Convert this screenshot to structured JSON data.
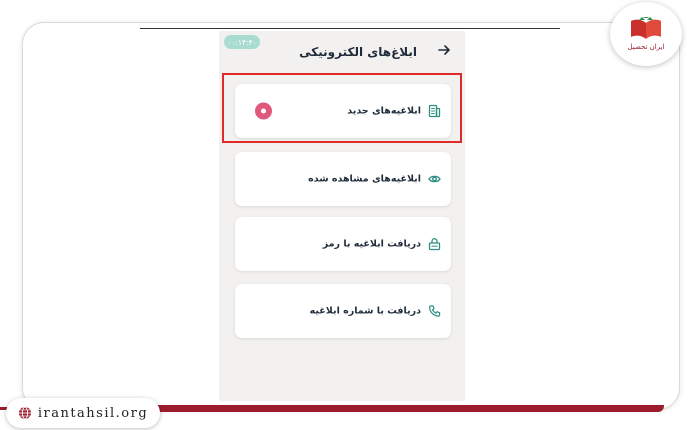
{
  "status_bar": {
    "time": "۰۰:۱۴:۳۰"
  },
  "header": {
    "title": "ابلاغ‌های الکترونیکی",
    "back_icon": "arrow-right-icon"
  },
  "menu": [
    {
      "label": "ابلاغیه‌های جدید",
      "icon": "document-icon",
      "badge": "new-notification-badge"
    },
    {
      "label": "ابلاغیه‌های مشاهده شده",
      "icon": "eye-icon"
    },
    {
      "label": "دریافت ابلاغیه با رمز",
      "icon": "lock-icon"
    },
    {
      "label": "دریافت با شماره ابلاغیه",
      "icon": "phone-icon"
    }
  ],
  "brand": {
    "logo_text": "ایران تحصیل",
    "website": "irantahsil.org"
  },
  "colors": {
    "accent": "#9c1c2e",
    "highlight": "#e02a2a",
    "badge": "#e0597c",
    "icon_teal": "#2f8f83",
    "status_pill": "#a8dcd0"
  }
}
